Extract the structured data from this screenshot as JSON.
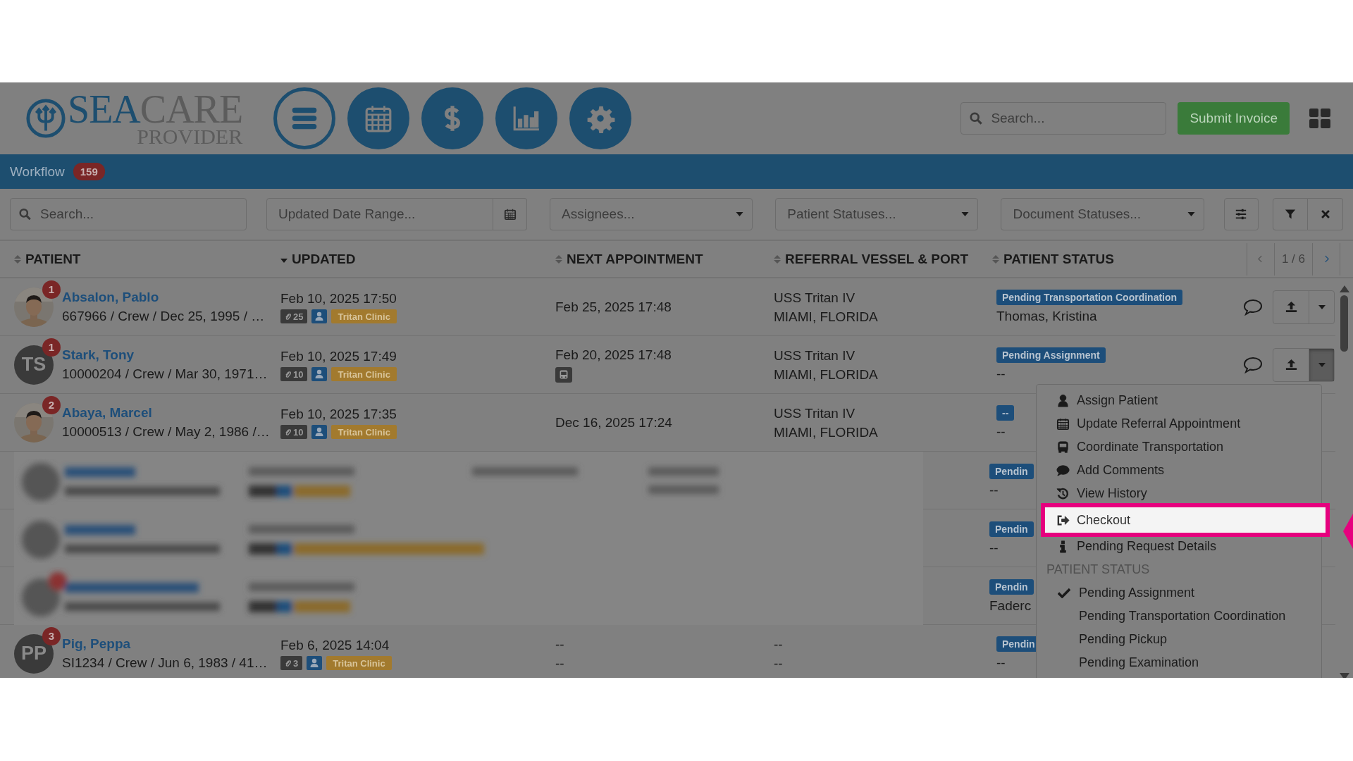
{
  "header": {
    "logo": {
      "word_1": "SEA",
      "word_2": "CARE",
      "subtitle": "PROVIDER"
    },
    "nav_icons": [
      {
        "kind": "menu",
        "selected": true
      },
      {
        "kind": "calendar",
        "selected": false
      },
      {
        "kind": "dollar",
        "selected": false
      },
      {
        "kind": "chart",
        "selected": false
      },
      {
        "kind": "settings",
        "selected": false
      }
    ],
    "search": {
      "placeholder": "Search..."
    },
    "submit_button": "Submit Invoice"
  },
  "nav_bar": {
    "title": "Workflow",
    "count": "159"
  },
  "filters": {
    "search": {
      "placeholder": "Search..."
    },
    "date_range": {
      "placeholder": "Updated Date Range..."
    },
    "assignees": {
      "placeholder": "Assignees..."
    },
    "patient_statuses": {
      "placeholder": "Patient Statuses..."
    },
    "document_statuses": {
      "placeholder": "Document Statuses..."
    }
  },
  "table": {
    "columns": [
      {
        "label": "PATIENT",
        "sorted_descending": false
      },
      {
        "label": "UPDATED",
        "sorted_descending": true
      },
      {
        "label": "NEXT APPOINTMENT",
        "sorted_descending": false
      },
      {
        "label": "REFERRAL VESSEL & PORT",
        "sorted_descending": false
      },
      {
        "label": "PATIENT STATUS",
        "sorted_descending": false
      }
    ],
    "page": "1 / 6",
    "rows": [
      {
        "notifications": "1",
        "name": "Absalon, Pablo",
        "details": "667966 / Crew / Dec 25, 1995 / …",
        "updated": "Feb 10, 2025 17:50",
        "attachments": "25",
        "clinic": "Tritan Clinic",
        "next_appointment": [
          "Feb 25, 2025 17:48"
        ],
        "transport": false,
        "vessel": "USS Tritan IV",
        "port": "MIAMI, FLORIDA",
        "status": "Pending Transportation Coordination",
        "assignee": "Thomas, Kristina",
        "actions_visible": true,
        "menu_open": false
      },
      {
        "kind": "initials",
        "initials": "TS",
        "notifications": "1",
        "name": "Stark, Tony",
        "details": "10000204 / Crew / Mar 30, 1971…",
        "updated": "Feb 10, 2025 17:49",
        "attachments": "10",
        "clinic": "Tritan Clinic",
        "next_appointment": [
          "Feb 20, 2025 17:48"
        ],
        "transport": true,
        "vessel": "USS Tritan IV",
        "port": "MIAMI, FLORIDA",
        "status": "Pending Assignment",
        "assignee": "--",
        "actions_visible": true,
        "menu_open": true
      },
      {
        "notifications": "2",
        "name": "Abaya, Marcel",
        "details": "10000513 / Crew / May 2, 1986 /…",
        "updated": "Feb 10, 2025 17:35",
        "attachments": "10",
        "clinic": "Tritan Clinic",
        "next_appointment": [
          "Dec 16, 2025 17:24"
        ],
        "transport": false,
        "vessel": "USS Tritan IV",
        "port": "MIAMI, FLORIDA",
        "status": "--",
        "assignee": "--",
        "actions_visible": false
      },
      {
        "kind": "blurred",
        "status": "Pendin",
        "assignee": "--"
      },
      {
        "kind": "blurred",
        "status": "Pendin",
        "assignee": "--"
      },
      {
        "kind": "blurred",
        "status": "Pendin",
        "assignee": "Faderc"
      },
      {
        "kind": "initials",
        "initials": "PP",
        "notifications": "3",
        "name": "Pig, Peppa",
        "details": "SI1234 / Crew / Jun 6, 1983 / 41…",
        "updated": "Feb 6, 2025 14:04",
        "attachments": "3",
        "clinic": "Tritan Clinic",
        "next_appointment": [
          "--",
          "--"
        ],
        "transport": false,
        "vessel": "--",
        "port": "--",
        "status": "Pendin",
        "assignee": "--",
        "actions_visible": false
      }
    ]
  },
  "menu": {
    "actions": [
      {
        "kind": "user",
        "label": "Assign Patient",
        "highlighted": false
      },
      {
        "kind": "calendar",
        "label": "Update Referral Appointment",
        "highlighted": false
      },
      {
        "kind": "bus",
        "label": "Coordinate Transportation",
        "highlighted": false
      },
      {
        "kind": "comment",
        "label": "Add Comments",
        "highlighted": false
      },
      {
        "kind": "history",
        "label": "View History",
        "highlighted": false
      },
      {
        "kind": "checkout",
        "label": "Checkout",
        "highlighted": true
      },
      {
        "kind": "info",
        "label": "Pending Request Details",
        "highlighted": false
      }
    ],
    "section": "PATIENT STATUS",
    "statuses": [
      {
        "label": "Pending Assignment",
        "checked": true
      },
      {
        "label": "Pending Transportation Coordination",
        "checked": false
      },
      {
        "label": "Pending Pickup",
        "checked": false
      },
      {
        "label": "Pending Examination",
        "checked": false
      }
    ]
  }
}
